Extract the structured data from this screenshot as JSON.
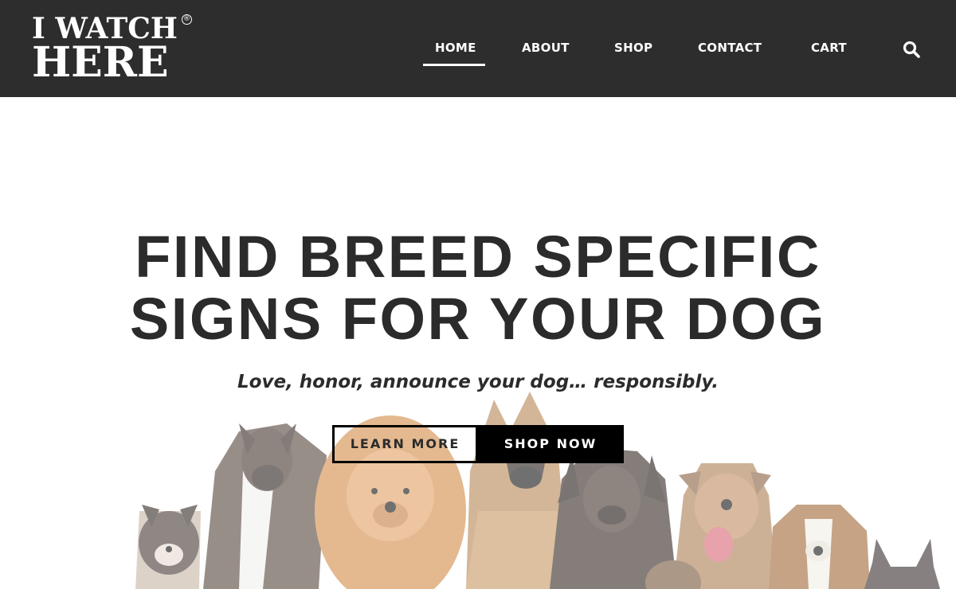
{
  "header": {
    "logo": {
      "line1": "I WATCH",
      "line2": "HERE",
      "mark": "®"
    },
    "nav": {
      "home": "HOME",
      "about": "ABOUT",
      "shop": "SHOP",
      "contact": "CONTACT",
      "cart": "CART",
      "active": "HOME",
      "search_icon": "search-icon"
    }
  },
  "hero": {
    "title_line1": "FIND BREED SPECIFIC",
    "title_line2": "SIGNS FOR YOUR DOG",
    "subtitle": "Love, honor, announce your dog… responsibly.",
    "learn_more": "LEARN MORE",
    "shop_now": "SHOP NOW"
  },
  "colors": {
    "header_bg": "#2e2d2d",
    "text_dark": "#2b2b2b",
    "button_dark": "#000000",
    "white": "#ffffff"
  }
}
